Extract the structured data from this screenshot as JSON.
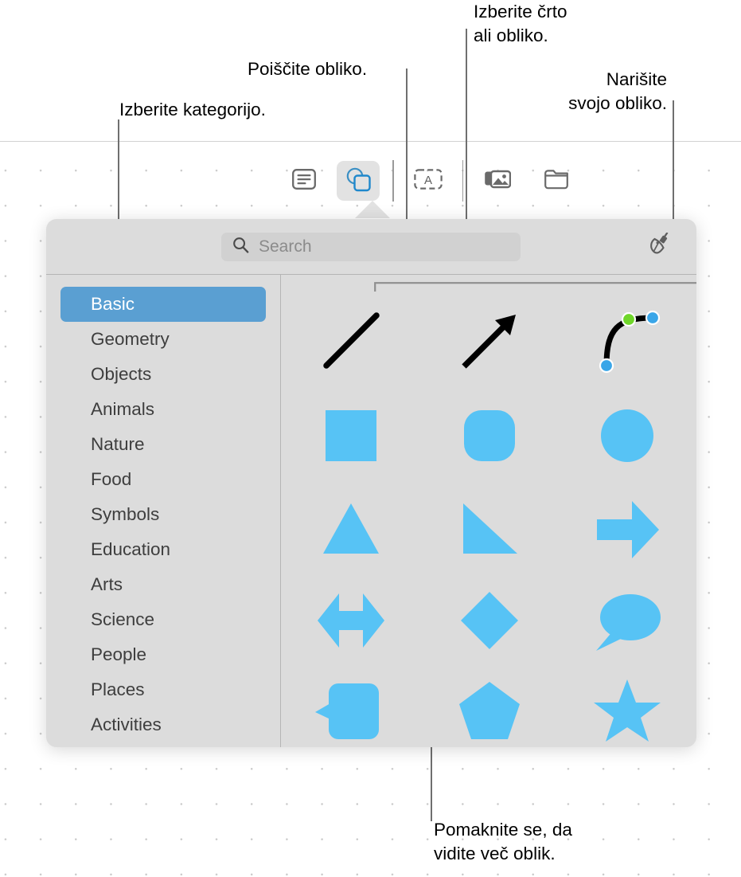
{
  "callouts": {
    "category": "Izberite kategorijo.",
    "search": "Poiščite obliko.",
    "line_or_shape": "Izberite črto\nali obliko.",
    "draw": "Narišite\nsvojo obliko.",
    "scroll": "Pomaknite se, da\nvidite več oblik."
  },
  "toolbar": {
    "buttons": [
      {
        "name": "text-button",
        "icon": "text-box-icon",
        "active": false
      },
      {
        "name": "shapes-button",
        "icon": "shapes-icon",
        "active": true
      },
      {
        "name": "table-button",
        "icon": "text-field-icon",
        "active": false
      },
      {
        "name": "media-button",
        "icon": "photos-icon",
        "active": false
      },
      {
        "name": "folder-button",
        "icon": "folder-icon",
        "active": false
      }
    ]
  },
  "search": {
    "placeholder": "Search",
    "icon": "search-icon"
  },
  "draw_tool": {
    "icon": "pen-icon",
    "label": "Draw"
  },
  "sidebar": {
    "items": [
      {
        "label": "Basic",
        "selected": true
      },
      {
        "label": "Geometry",
        "selected": false
      },
      {
        "label": "Objects",
        "selected": false
      },
      {
        "label": "Animals",
        "selected": false
      },
      {
        "label": "Nature",
        "selected": false
      },
      {
        "label": "Food",
        "selected": false
      },
      {
        "label": "Symbols",
        "selected": false
      },
      {
        "label": "Education",
        "selected": false
      },
      {
        "label": "Arts",
        "selected": false
      },
      {
        "label": "Science",
        "selected": false
      },
      {
        "label": "People",
        "selected": false
      },
      {
        "label": "Places",
        "selected": false
      },
      {
        "label": "Activities",
        "selected": false
      }
    ]
  },
  "shapes": {
    "accent_color": "#57c3f5",
    "line_color": "#000000",
    "handle_blue": "#3aa6e8",
    "handle_green": "#6fd62a",
    "rows": [
      [
        {
          "name": "shape-line",
          "label": "Line"
        },
        {
          "name": "shape-arrow",
          "label": "Arrow"
        },
        {
          "name": "shape-bezier-curve",
          "label": "Curve"
        }
      ],
      [
        {
          "name": "shape-square",
          "label": "Square"
        },
        {
          "name": "shape-rounded-square",
          "label": "Rounded Square"
        },
        {
          "name": "shape-circle",
          "label": "Circle"
        }
      ],
      [
        {
          "name": "shape-triangle",
          "label": "Triangle"
        },
        {
          "name": "shape-right-triangle",
          "label": "Right Triangle"
        },
        {
          "name": "shape-right-arrow",
          "label": "Right Arrow"
        }
      ],
      [
        {
          "name": "shape-double-arrow",
          "label": "Double Arrow"
        },
        {
          "name": "shape-diamond",
          "label": "Diamond"
        },
        {
          "name": "shape-speech-bubble",
          "label": "Speech Bubble"
        }
      ],
      [
        {
          "name": "shape-callout-box",
          "label": "Callout"
        },
        {
          "name": "shape-pentagon",
          "label": "Pentagon"
        },
        {
          "name": "shape-star",
          "label": "Star"
        }
      ]
    ]
  }
}
